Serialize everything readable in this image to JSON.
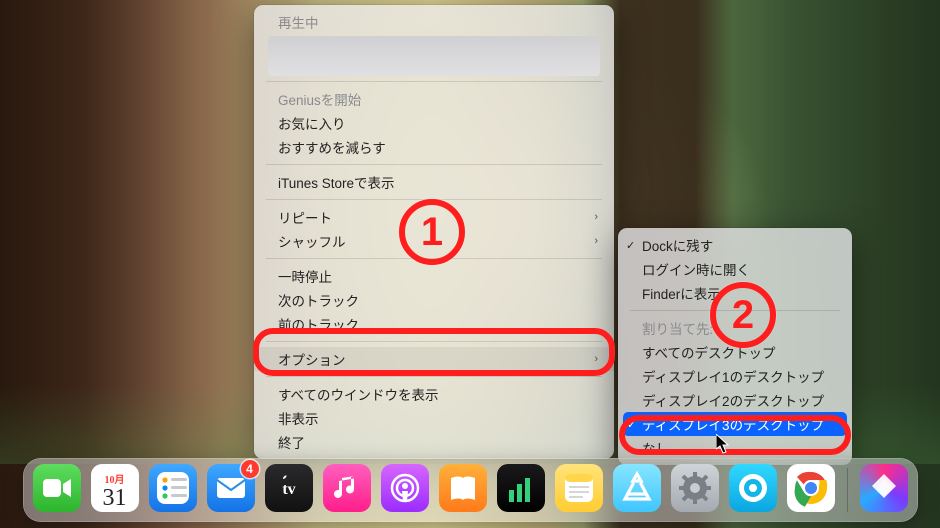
{
  "menu": {
    "now_playing_header": "再生中",
    "genius_start": "Geniusを開始",
    "favorites": "お気に入り",
    "recommend_less": "おすすめを減らす",
    "show_in_store": "iTunes Storeで表示",
    "repeat": "リピート",
    "shuffle": "シャッフル",
    "pause": "一時停止",
    "next_track": "次のトラック",
    "prev_track": "前のトラック",
    "options": "オプション",
    "show_all_windows": "すべてのウインドウを表示",
    "hide": "非表示",
    "quit": "終了"
  },
  "submenu": {
    "keep_in_dock": "Dockに残す",
    "open_at_login": "ログイン時に開く",
    "show_in_finder": "Finderに表示",
    "assign_to_header": "割り当て先:",
    "all_desktops": "すべてのデスクトップ",
    "display1": "ディスプレイ1のデスクトップ",
    "display2": "ディスプレイ2のデスクトップ",
    "display3": "ディスプレイ3のデスクトップ",
    "none": "なし"
  },
  "dock": {
    "calendar_month": "10月",
    "calendar_day": "31",
    "mail_badge": "4"
  },
  "annotation": {
    "one": "1",
    "two": "2"
  }
}
